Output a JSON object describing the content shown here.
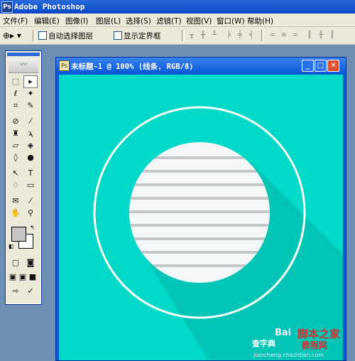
{
  "app": {
    "title": "Adobe Photoshop",
    "logo_text": "Ps"
  },
  "menu": [
    "文件(F)",
    "编辑(E)",
    "图像(I)",
    "图层(L)",
    "选择(S)",
    "滤镜(T)",
    "视图(V)",
    "窗口(W)",
    "帮助(H)"
  ],
  "options": {
    "tool_icon": "move-tool-icon",
    "auto_select_label": "自动选择图层",
    "show_bounds_label": "显示定界框"
  },
  "document": {
    "title": "未标题-1 @ 100% (线条, RGB/8)",
    "minimize": "_",
    "maximize": "□",
    "close": "✕"
  },
  "colors": {
    "canvas": "#00d9c8",
    "shadow": "#02c5b5",
    "white": "#ffffff",
    "stripe": "#c3c7c8",
    "disc": "#f5f6f7"
  },
  "watermark": {
    "main": "Bai",
    "side1": "脚本之家",
    "side2": "教程网",
    "tag": "查字典",
    "url": "jiaocheng.chazidian.com"
  }
}
